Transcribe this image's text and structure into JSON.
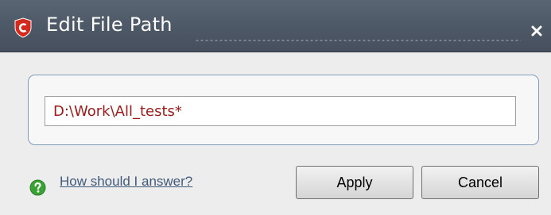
{
  "window": {
    "title": "Edit File Path",
    "close_glyph": "×",
    "app_icon": "comodo-shield-icon",
    "title_bar_color": "#4f5a68"
  },
  "form": {
    "path_value": "D:\\Work\\All_tests*",
    "path_text_color": "#9b1b1b"
  },
  "footer": {
    "help_icon": "question-circle-icon",
    "help_link": "How should I answer?",
    "apply_label": "Apply",
    "cancel_label": "Cancel"
  }
}
